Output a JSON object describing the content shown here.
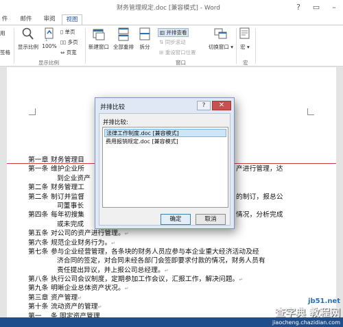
{
  "window": {
    "title": "财务管理规定.doc [兼容模式] - Word"
  },
  "tabs": {
    "left_fragment": "件",
    "mailings": "邮件",
    "review": "审阅",
    "view": "视图"
  },
  "ribbon": {
    "left_partial": {
      "a": "用",
      "b": "签格"
    },
    "zoom_group": {
      "zoom_ratio": "显示比例",
      "hundred": "100%",
      "one_page": "单页",
      "multi_page": "多页",
      "page_width": "页宽",
      "label": "显示比例"
    },
    "window_group": {
      "new_window": "新建窗口",
      "arrange_all": "全部重排",
      "split": "拆分",
      "side_by_side": "并排查看",
      "sync_scroll": "同步滚动",
      "reset_position": "重设窗口位置",
      "switch_window": "切换窗口",
      "label": "窗口"
    },
    "macro_group": {
      "macro": "宏",
      "label": "宏"
    }
  },
  "document": {
    "lines": [
      {
        "num": "第一章",
        "text": "财务管理目"
      },
      {
        "num": "第一条",
        "text": "维护企业所",
        "tail": "产进行管理，达"
      },
      {
        "cont": true,
        "text": "到企业资产"
      },
      {
        "num": "第二条",
        "text": "财务管理工"
      },
      {
        "num": "第二条",
        "text": "制订并监督",
        "tail": "的制订，报总公"
      },
      {
        "cont": true,
        "text": "司董事长"
      },
      {
        "num": "第四条",
        "text": "每年初搜集",
        "tail": "情况，分析完成"
      },
      {
        "cont": true,
        "text": "或未完成"
      },
      {
        "num": "第五条",
        "text": "对公司的资产进行管理。"
      },
      {
        "num": "第六条",
        "text": "规范企业财务行为。"
      },
      {
        "num": "第七条",
        "text": "参与企业经营管理，各条块的财务人员应参与本企业重大经济活动及经"
      },
      {
        "cont": true,
        "text": "济合同的签定，对合同未经各部门会签即要求付款的情况，财务人员有"
      },
      {
        "cont": true,
        "text": "责任提出异议，并上报公司总经理。"
      },
      {
        "num": "第八条",
        "text": "执行公司会议制度，定期参加工作会议，汇报工作，解决问题。"
      },
      {
        "num": "第九条",
        "text": "明晰企业总体资产状况。"
      },
      {
        "num": "第三章",
        "text": "资产管理"
      },
      {
        "num": "第十条",
        "text": "流动资产的管理"
      },
      {
        "num": "第一",
        "text": "条 固定资产管理"
      }
    ]
  },
  "dialog": {
    "title": "并排比较",
    "help": "?",
    "close": "✕",
    "label": "并排比较:",
    "items": [
      "法律工作制度.doc [兼容模式]",
      "费用报销规定.doc [兼容模式]"
    ],
    "ok": "确定",
    "cancel": "取消"
  },
  "watermark": {
    "site": "jb51.net",
    "main": "查字典 教程网",
    "url": "jiaocheng.chazidian.com"
  }
}
